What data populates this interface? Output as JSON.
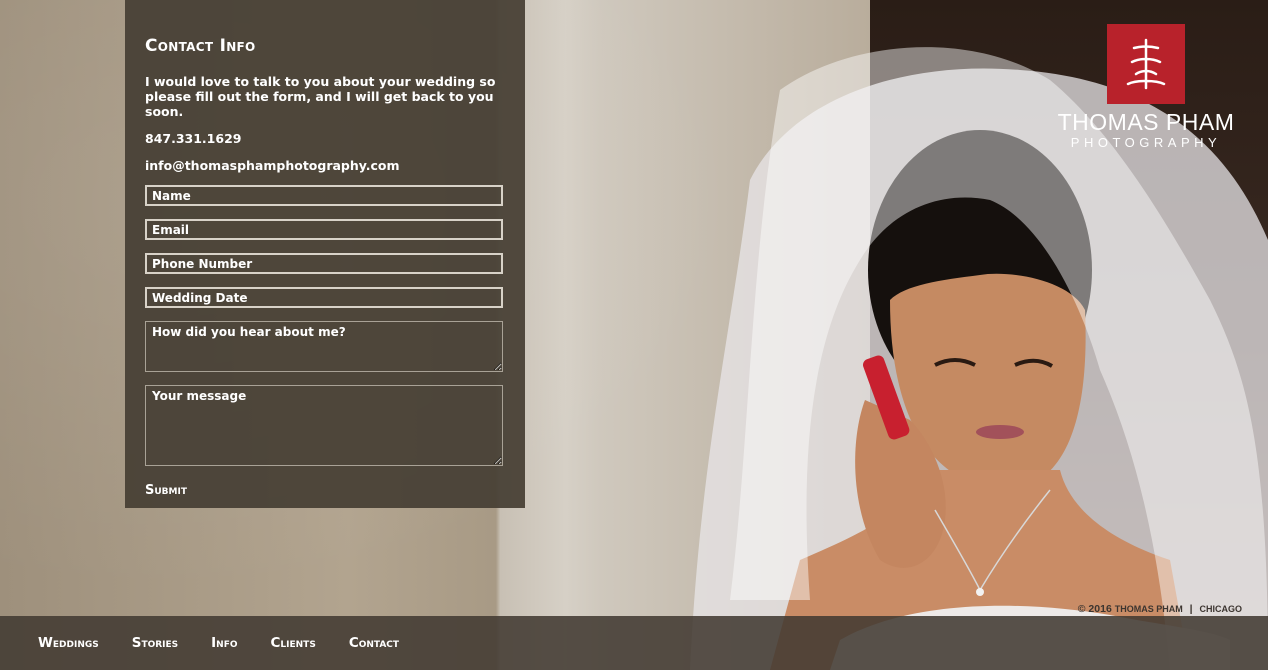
{
  "contact": {
    "title": "Contact Info",
    "intro": "I would love to talk to you about your wedding so please fill out the form, and I will get back to you soon.",
    "phone": "847.331.1629",
    "email": "info@thomasphamphotography.com"
  },
  "form": {
    "name_placeholder": "Name",
    "email_placeholder": "Email",
    "phone_placeholder": "Phone Number",
    "date_placeholder": "Wedding Date",
    "referral_placeholder": "How did you hear about me?",
    "message_placeholder": "Your message",
    "submit_label": "Submit"
  },
  "logo": {
    "name": "THOMAS PHAM",
    "subtitle": "PHOTOGRAPHY",
    "brand_color": "#b8222b"
  },
  "copyright": {
    "symbol_year": "© 2016",
    "owner": "Thomas Pham",
    "separator": "|",
    "city": "Chicago"
  },
  "nav": {
    "items": [
      {
        "label": "Weddings"
      },
      {
        "label": "Stories"
      },
      {
        "label": "Info"
      },
      {
        "label": "Clients"
      },
      {
        "label": "Contact"
      }
    ]
  }
}
